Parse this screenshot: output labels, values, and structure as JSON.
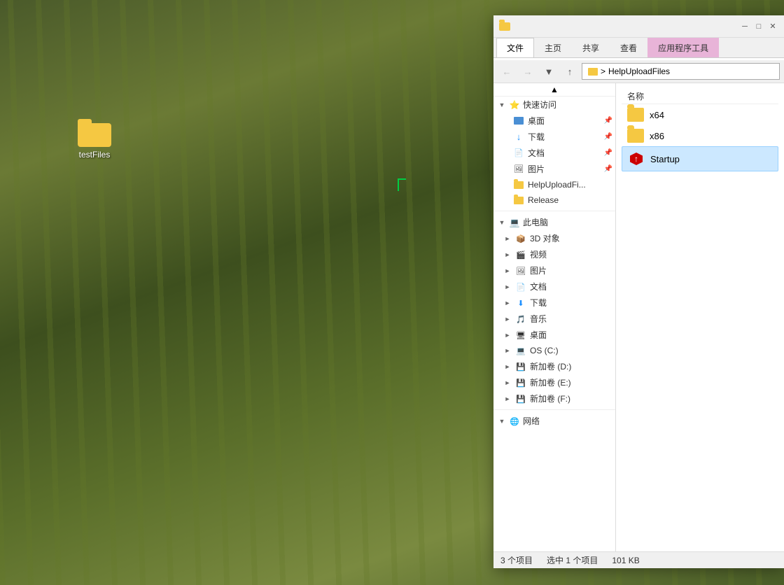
{
  "desktop": {
    "icon": {
      "label": "testFiles"
    }
  },
  "explorer": {
    "title": "HelpUploadFiles",
    "ribbon": {
      "tabs": [
        {
          "id": "file",
          "label": "文件",
          "active": true
        },
        {
          "id": "home",
          "label": "主页",
          "active": false
        },
        {
          "id": "share",
          "label": "共享",
          "active": false
        },
        {
          "id": "view",
          "label": "查看",
          "active": false
        },
        {
          "id": "manage",
          "label": "应用程序工具",
          "active": false,
          "style": "manage"
        }
      ]
    },
    "address": {
      "path": "HelpUploadFiles"
    },
    "nav": {
      "quick_access_label": "快速访问",
      "items": [
        {
          "id": "desktop",
          "label": "桌面",
          "pinned": true,
          "icon": "desktop-icon"
        },
        {
          "id": "downloads",
          "label": "下载",
          "pinned": true,
          "icon": "download-icon"
        },
        {
          "id": "documents",
          "label": "文档",
          "pinned": true,
          "icon": "doc-icon"
        },
        {
          "id": "pictures",
          "label": "图片",
          "pinned": true,
          "icon": "pic-icon"
        },
        {
          "id": "helpupload",
          "label": "HelpUploadFi...",
          "pinned": false,
          "icon": "folder-icon"
        },
        {
          "id": "release",
          "label": "Release",
          "pinned": false,
          "icon": "folder-icon"
        }
      ],
      "this_pc_label": "此电脑",
      "pc_items": [
        {
          "id": "3d",
          "label": "3D 对象",
          "icon": "3d-icon"
        },
        {
          "id": "video",
          "label": "视频",
          "icon": "video-icon"
        },
        {
          "id": "pictures2",
          "label": "图片",
          "icon": "pic2-icon"
        },
        {
          "id": "documents2",
          "label": "文档",
          "icon": "doc2-icon"
        },
        {
          "id": "downloads2",
          "label": "下载",
          "icon": "dl2-icon"
        },
        {
          "id": "music",
          "label": "音乐",
          "icon": "music-icon"
        },
        {
          "id": "desktop2",
          "label": "桌面",
          "icon": "desk2-icon"
        },
        {
          "id": "os_c",
          "label": "OS (C:)",
          "icon": "c-icon"
        },
        {
          "id": "vol_d",
          "label": "新加卷 (D:)",
          "icon": "d-icon"
        },
        {
          "id": "vol_e",
          "label": "新加卷 (E:)",
          "icon": "e-icon"
        },
        {
          "id": "vol_f",
          "label": "新加卷 (F:)",
          "icon": "f-icon"
        }
      ],
      "network_label": "网络"
    },
    "files": {
      "col_name": "名称",
      "items": [
        {
          "id": "x64",
          "label": "x64",
          "type": "folder",
          "selected": false
        },
        {
          "id": "x86",
          "label": "x86",
          "type": "folder",
          "selected": false
        },
        {
          "id": "startup",
          "label": "Startup",
          "type": "startup",
          "selected": true
        }
      ]
    },
    "status": {
      "count": "3 个项目",
      "selected": "选中 1 个项目",
      "size": "101 KB"
    }
  }
}
